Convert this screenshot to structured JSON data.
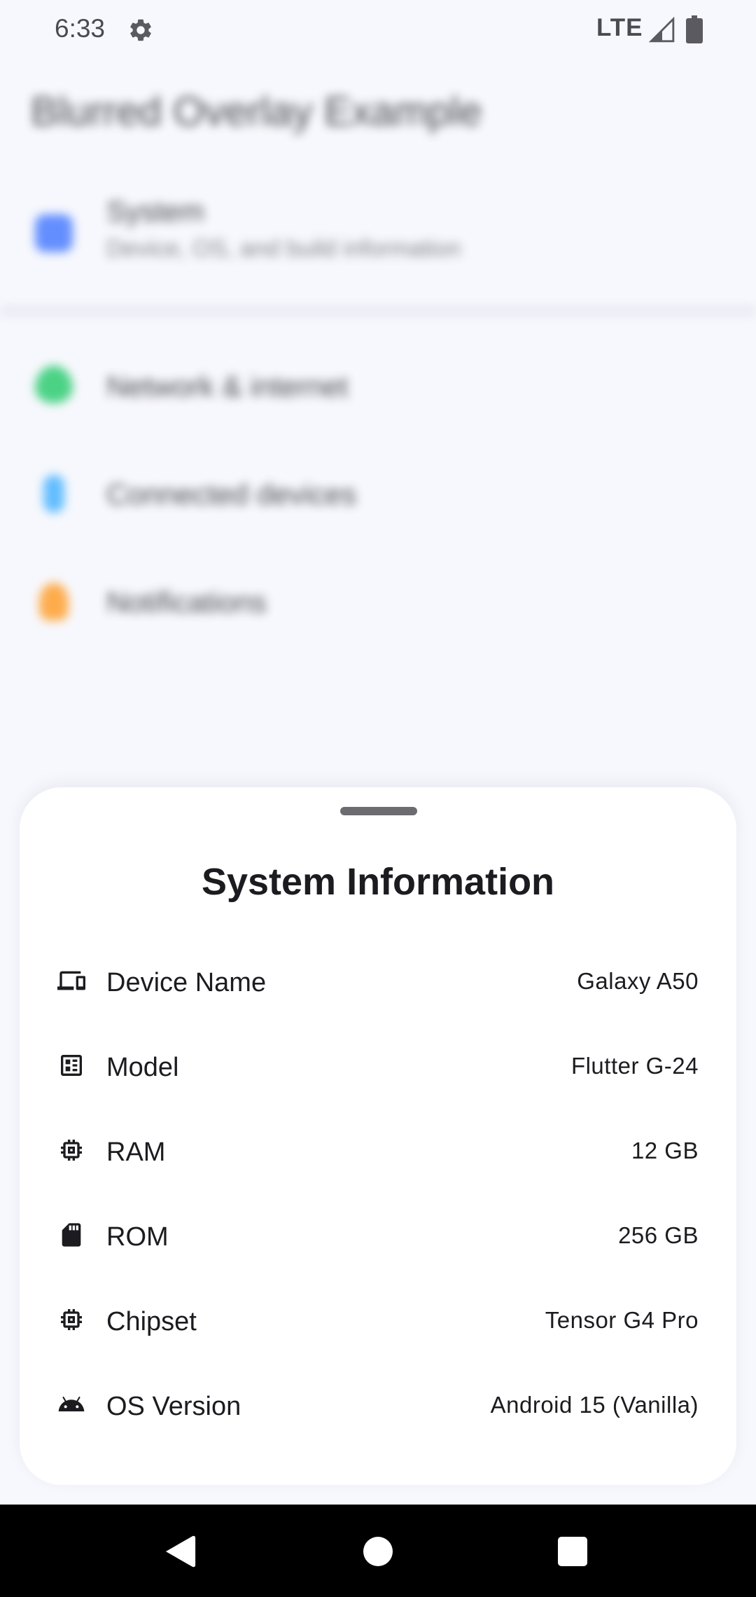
{
  "status_bar": {
    "time": "6:33",
    "network": "LTE",
    "icons": [
      "gear-icon",
      "signal-icon",
      "battery-icon"
    ]
  },
  "background_app": {
    "title": "Blurred Overlay Example",
    "items": [
      {
        "label": "System",
        "subtitle": "Device, OS, and build information",
        "icon": "phone-icon",
        "color": "#4a7dff"
      },
      {
        "label": "Network & internet",
        "icon": "wifi-icon",
        "color": "#2ecc71"
      },
      {
        "label": "Connected devices",
        "icon": "bluetooth-icon",
        "color": "#4ab3ff"
      },
      {
        "label": "Notifications",
        "icon": "bell-icon",
        "color": "#ff9f2e"
      }
    ]
  },
  "sheet": {
    "title": "System Information",
    "rows": [
      {
        "label": "Device Name",
        "value": "Galaxy A50",
        "icon": "devices-icon"
      },
      {
        "label": "Model",
        "value": "Flutter G-24",
        "icon": "model-icon"
      },
      {
        "label": "RAM",
        "value": "12 GB",
        "icon": "memory-icon"
      },
      {
        "label": "ROM",
        "value": "256 GB",
        "icon": "sd-card-icon"
      },
      {
        "label": "Chipset",
        "value": "Tensor G4 Pro",
        "icon": "chip-icon"
      },
      {
        "label": "OS Version",
        "value": "Android 15 (Vanilla)",
        "icon": "android-icon"
      }
    ]
  },
  "nav_bar": {
    "icons": [
      "back-icon",
      "home-icon",
      "recents-icon"
    ]
  }
}
